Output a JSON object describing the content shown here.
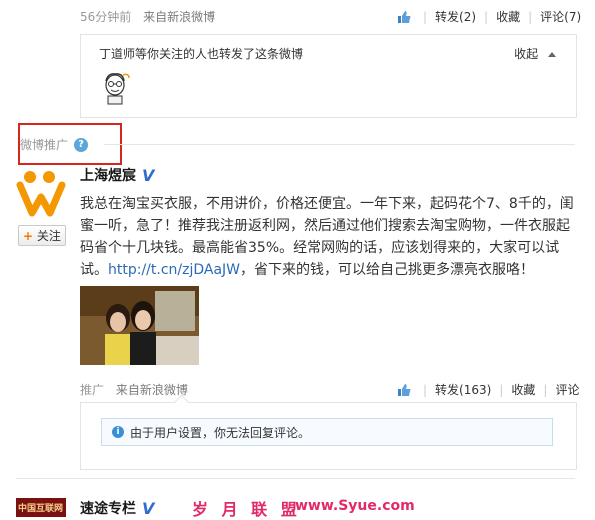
{
  "top_post": {
    "time": "56分钟前",
    "source": "来自新浪微博",
    "actions": {
      "forward": "转发(2)",
      "favorite": "收藏",
      "comment": "评论(7)"
    }
  },
  "forward_box": {
    "text": "丁道师等你关注的人也转发了这条微博",
    "collapse": "收起"
  },
  "promo": {
    "label": "微博推广",
    "help": "?"
  },
  "ad_post": {
    "author": "上海煜宸",
    "verified": "V",
    "follow": "关注",
    "follow_plus": "+",
    "text_before_link": "我总在淘宝买衣服，不用讲价，价格还便宜。一年下来，起码花个7、8千的，闺蜜一听，急了！推荐我注册返利网，然后通过他们搜索去淘宝购物，一件衣服起码省个十几块钱。最高能省35%。经常网购的话，应该划得来的，大家可以试试。",
    "link": "http://t.cn/zjDAaJW",
    "text_after_link": "，省下来的钱，可以给自己挑更多漂亮衣服咯！",
    "meta_tag": "推广",
    "source": "来自新浪微博",
    "actions": {
      "forward": "转发(163)",
      "favorite": "收藏",
      "comment": "评论"
    },
    "notice": "由于用户设置，你无法回复评论。",
    "notice_icon": "i"
  },
  "next_post": {
    "author": "速途专栏",
    "verified": "V",
    "thumb_text": "中国互联网",
    "watermark": "岁 月 联 盟",
    "watermark_url": "www.Syue.com"
  },
  "colors": {
    "link": "#2b6bb5",
    "verified": "#2f6fcb",
    "red_box": "#d9261c",
    "watermark": "#e12a6a"
  }
}
